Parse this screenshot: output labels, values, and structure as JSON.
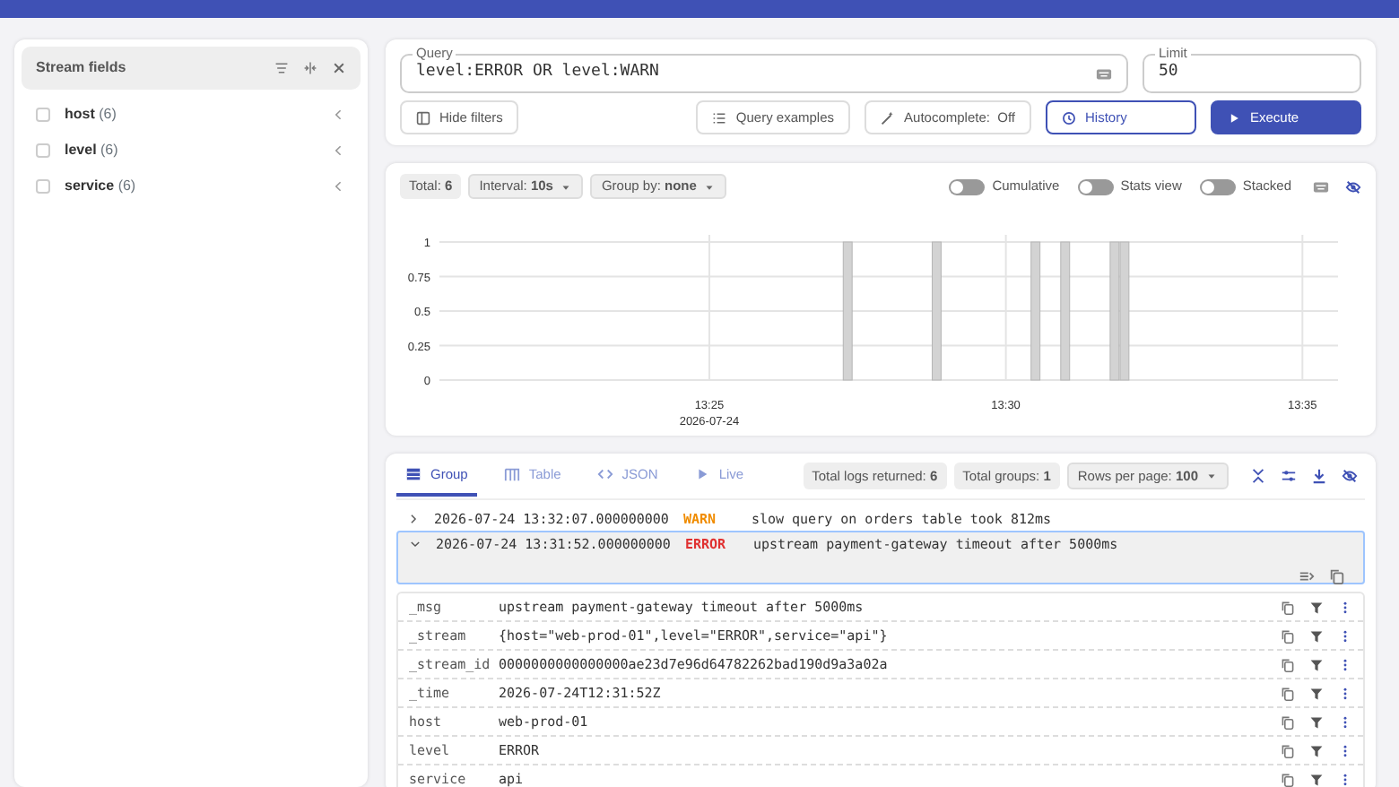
{
  "sidebar": {
    "title": "Stream fields",
    "fields": [
      {
        "name": "host",
        "count": "(6)",
        "checked": false
      },
      {
        "name": "level",
        "count": "(6)",
        "checked": false
      },
      {
        "name": "service",
        "count": "(6)",
        "checked": false
      }
    ]
  },
  "query": {
    "label": "Query",
    "value": "level:ERROR OR level:WARN"
  },
  "limit": {
    "label": "Limit",
    "value": "50"
  },
  "buttons": [
    {
      "label": "Hide filters",
      "kind": "hide"
    },
    {
      "label": "Query examples",
      "kind": "examples"
    },
    {
      "label": "Autocomplete:  Off",
      "kind": "autocomplete"
    },
    {
      "label": "History",
      "kind": "history"
    },
    {
      "label": "Execute",
      "kind": "execute"
    }
  ],
  "chart_panel": {
    "total": "Total: **6**",
    "selectors": [
      "Interval: **10s**",
      "Group by: **none**"
    ],
    "toggles": [
      {
        "label": "Cumulative",
        "on": false
      },
      {
        "label": "Stats view",
        "on": false
      },
      {
        "label": "Stacked",
        "on": false
      }
    ],
    "date_label": "2026-07-24",
    "chart_data": {
      "type": "bar",
      "grid": true,
      "x": [
        807.333,
        808.833,
        810.5,
        811.0,
        811.833,
        812.0
      ],
      "values": [
        1,
        1,
        1,
        1,
        1,
        1
      ],
      "xlim": [
        800.45,
        815.6
      ],
      "ylim": [
        0,
        1
      ],
      "xticks": [
        {
          "value": 805,
          "label": "13:25"
        },
        {
          "value": 810,
          "label": "13:30"
        },
        {
          "value": 815,
          "label": "13:35"
        }
      ],
      "yticks": [
        0,
        0.25,
        0.5,
        0.75,
        1
      ]
    }
  },
  "logs": {
    "tabs": [
      {
        "label": "Group",
        "selected": true
      },
      {
        "label": "Table",
        "selected": false
      },
      {
        "label": "JSON",
        "selected": false
      },
      {
        "label": "Live",
        "selected": false
      }
    ],
    "stats": [
      "Total logs returned: **6**",
      "Total groups: **1**"
    ],
    "rows_per_page": "Rows per page: **100**",
    "rows": [
      {
        "time": "2026-07-24 13:32:07.000000000",
        "level": "WARN",
        "color": "#f08c00",
        "message": "slow query on orders table took 812ms",
        "expanded": false
      },
      {
        "time": "2026-07-24 13:31:52.000000000",
        "level": "ERROR",
        "color": "#e03131",
        "message": "upstream payment-gateway timeout after 5000ms",
        "expanded": true
      }
    ],
    "fields": [
      {
        "key": "_msg",
        "value": "upstream payment-gateway timeout after 5000ms"
      },
      {
        "key": "_stream",
        "value": "{host=\"web-prod-01\",level=\"ERROR\",service=\"api\"}"
      },
      {
        "key": "_stream_id",
        "value": "0000000000000000ae23d7e96d64782262bad190d9a3a02a"
      },
      {
        "key": "_time",
        "value": "2026-07-24T12:31:52Z"
      },
      {
        "key": "host",
        "value": "web-prod-01"
      },
      {
        "key": "level",
        "value": "ERROR"
      },
      {
        "key": "service",
        "value": "api"
      }
    ]
  }
}
